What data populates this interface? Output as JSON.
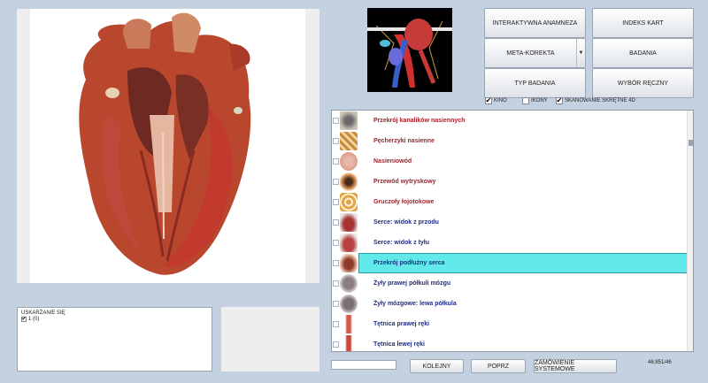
{
  "header_buttons": {
    "interactive_anamnesis": "INTERAKTYWNA ANAMNEZA",
    "card_index": "INDEKS KART",
    "meta_correction": "META-KOREKTA",
    "studies": "BADANIA",
    "study_type": "TYP BADANIA",
    "manual_selection": "WYBÓR RĘCZNY"
  },
  "options": {
    "kino": {
      "label": "KINO",
      "checked": true
    },
    "ikony": {
      "label": "IKONY",
      "checked": false
    },
    "skanowanie": {
      "label": "SKANOWANIE SKRĘTNE 4D",
      "checked": true
    }
  },
  "list_items": [
    {
      "label": "Przekrój kanalików nasiennych",
      "tone": "red",
      "icon": "tubules-section-icon"
    },
    {
      "label": "Pęcherzyki nasienne",
      "tone": "red",
      "icon": "seminal-vesicles-icon"
    },
    {
      "label": "Nasieniowód",
      "tone": "red",
      "icon": "vas-deferens-icon"
    },
    {
      "label": "Przewód wytryskowy",
      "tone": "red",
      "icon": "ejaculatory-duct-icon"
    },
    {
      "label": "Gruczoły łojotokowe",
      "tone": "red",
      "icon": "sebaceous-glands-icon"
    },
    {
      "label": "Serce: widok z przodu",
      "tone": "navy",
      "icon": "heart-front-icon"
    },
    {
      "label": "Serce: widok z tyłu",
      "tone": "navy",
      "icon": "heart-back-icon"
    },
    {
      "label": "Przekrój podłużny serca",
      "tone": "navy",
      "icon": "heart-section-icon",
      "selected": true
    },
    {
      "label": "Żyły prawej półkuli mózgu",
      "tone": "navy",
      "icon": "brain-right-icon"
    },
    {
      "label": "Żyły mózgowe: lewa półkula",
      "tone": "navy",
      "icon": "brain-left-icon"
    },
    {
      "label": "Tętnica prawej ręki",
      "tone": "navy",
      "icon": "right-arm-artery-icon"
    },
    {
      "label": "Tętnica lewej ręki",
      "tone": "navy",
      "icon": "left-arm-artery-icon"
    }
  ],
  "log": {
    "title": "USKARŻANIE SIĘ",
    "entry_text": "1 (0)",
    "entry_checked": true
  },
  "footer": {
    "next": "KOLEJNY",
    "prev": "POPRZ",
    "system_order": "ZAMÓWIENIE SYSTEMOWE",
    "counter": "46:851/46"
  },
  "colors": {
    "background": "#c4d1e1",
    "selection": "#62eaea",
    "label_red": "#a51f2a",
    "label_navy": "#1f2d86"
  }
}
